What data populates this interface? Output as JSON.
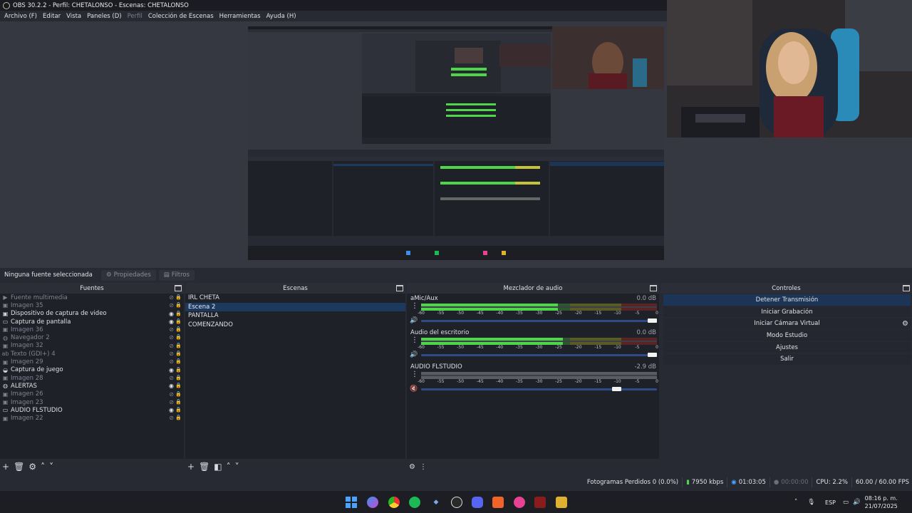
{
  "window": {
    "title": "OBS 30.2.2 - Perfil: CHETALONSO - Escenas: CHETALONSO"
  },
  "menu": [
    "Archivo (F)",
    "Editar",
    "Vista",
    "Paneles (D)",
    "Perfil",
    "Colección de Escenas",
    "Herramientas",
    "Ayuda (H)"
  ],
  "context_bar": {
    "no_source": "Ninguna fuente seleccionada",
    "properties": "Propiedades",
    "filters": "Filtros"
  },
  "sources": {
    "title": "Fuentes",
    "items": [
      {
        "label": "Fuente multimedia",
        "icon": "play-icon",
        "visible": false
      },
      {
        "label": "Imagen 35",
        "icon": "image-icon",
        "visible": false
      },
      {
        "label": "Dispositivo de captura de video",
        "icon": "camera-icon",
        "visible": true
      },
      {
        "label": "Captura de pantalla",
        "icon": "monitor-icon",
        "visible": true
      },
      {
        "label": "Imagen 36",
        "icon": "image-icon",
        "visible": false
      },
      {
        "label": "Navegador 2",
        "icon": "globe-icon",
        "visible": false
      },
      {
        "label": "Imagen 32",
        "icon": "image-icon",
        "visible": false
      },
      {
        "label": "Texto (GDI+) 4",
        "icon": "text-icon",
        "visible": false
      },
      {
        "label": "Imagen 29",
        "icon": "image-icon",
        "visible": false
      },
      {
        "label": "Captura de juego",
        "icon": "gamepad-icon",
        "visible": true
      },
      {
        "label": "Imagen 28",
        "icon": "image-icon",
        "visible": false
      },
      {
        "label": "ALERTAS",
        "icon": "globe-icon",
        "visible": true
      },
      {
        "label": "Imagen 26",
        "icon": "image-icon",
        "visible": false
      },
      {
        "label": "Imagen 23",
        "icon": "image-icon",
        "visible": false
      },
      {
        "label": "AUDIO FLSTUDIO",
        "icon": "monitor-icon",
        "visible": true
      },
      {
        "label": "Imagen 22",
        "icon": "image-icon",
        "visible": false
      }
    ]
  },
  "scenes": {
    "title": "Escenas",
    "items": [
      "IRL CHETA",
      "Escena 2",
      "PANTALLA",
      "COMENZANDO"
    ],
    "selected": "Escena 2"
  },
  "mixer": {
    "title": "Mezclador de audio",
    "ticks": [
      "-60",
      "-55",
      "-50",
      "-45",
      "-40",
      "-35",
      "-30",
      "-25",
      "-20",
      "-15",
      "-10",
      "-5",
      "0"
    ],
    "channels": [
      {
        "name": "aMic/Aux",
        "db": "0.0 dB",
        "level": 0.58,
        "muted": false,
        "volume": 1.0
      },
      {
        "name": "Audio del escritorio",
        "db": "0.0 dB",
        "level": 0.6,
        "muted": false,
        "volume": 1.0
      },
      {
        "name": "AUDIO FLSTUDIO",
        "db": "-2.9 dB",
        "level": 0.0,
        "muted": true,
        "volume": 0.85
      }
    ]
  },
  "controls": {
    "title": "Controles",
    "buttons": [
      "Detener Transmisión",
      "Iniciar Grabación",
      "Iniciar Cámara Virtual",
      "Modo Estudio",
      "Ajustes",
      "Salir"
    ]
  },
  "status": {
    "dropped": "Fotogramas Perdidos 0 (0.0%)",
    "bitrate": "7950 kbps",
    "stream_time": "01:03:05",
    "rec_time": "00:00:00",
    "cpu": "CPU: 2.2%",
    "fps": "60.00 / 60.00 FPS"
  },
  "taskbar": {
    "lang": "ESP",
    "time": "08:16 p. m.",
    "date": "21/07/2025",
    "apps": [
      "windows-start-icon",
      "copilot-icon",
      "chrome-icon",
      "spotify-icon",
      "tool-icon",
      "obs-icon",
      "discord-icon",
      "brave-icon",
      "osu-icon",
      "fl-studio-icon",
      "file-explorer-icon"
    ]
  },
  "colors": {
    "accent": "#1d3a5e",
    "meter_green": "#4fd54a",
    "meter_yellow": "#c6c23a",
    "meter_red": "#c53232",
    "slider": "#2e4a88"
  }
}
